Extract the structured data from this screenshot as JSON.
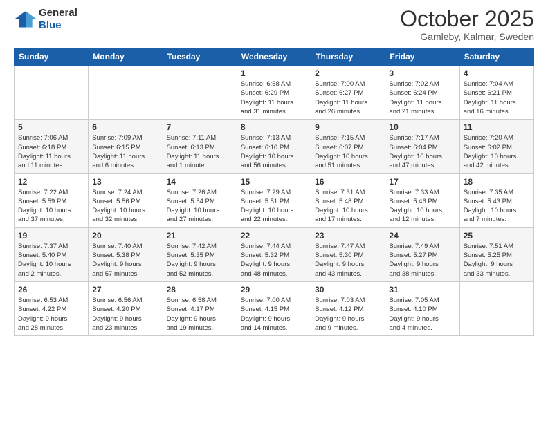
{
  "logo": {
    "general": "General",
    "blue": "Blue"
  },
  "header": {
    "month": "October 2025",
    "location": "Gamleby, Kalmar, Sweden"
  },
  "weekdays": [
    "Sunday",
    "Monday",
    "Tuesday",
    "Wednesday",
    "Thursday",
    "Friday",
    "Saturday"
  ],
  "weeks": [
    [
      {
        "day": "",
        "info": ""
      },
      {
        "day": "",
        "info": ""
      },
      {
        "day": "",
        "info": ""
      },
      {
        "day": "1",
        "info": "Sunrise: 6:58 AM\nSunset: 6:29 PM\nDaylight: 11 hours\nand 31 minutes."
      },
      {
        "day": "2",
        "info": "Sunrise: 7:00 AM\nSunset: 6:27 PM\nDaylight: 11 hours\nand 26 minutes."
      },
      {
        "day": "3",
        "info": "Sunrise: 7:02 AM\nSunset: 6:24 PM\nDaylight: 11 hours\nand 21 minutes."
      },
      {
        "day": "4",
        "info": "Sunrise: 7:04 AM\nSunset: 6:21 PM\nDaylight: 11 hours\nand 16 minutes."
      }
    ],
    [
      {
        "day": "5",
        "info": "Sunrise: 7:06 AM\nSunset: 6:18 PM\nDaylight: 11 hours\nand 11 minutes."
      },
      {
        "day": "6",
        "info": "Sunrise: 7:09 AM\nSunset: 6:15 PM\nDaylight: 11 hours\nand 6 minutes."
      },
      {
        "day": "7",
        "info": "Sunrise: 7:11 AM\nSunset: 6:13 PM\nDaylight: 11 hours\nand 1 minute."
      },
      {
        "day": "8",
        "info": "Sunrise: 7:13 AM\nSunset: 6:10 PM\nDaylight: 10 hours\nand 56 minutes."
      },
      {
        "day": "9",
        "info": "Sunrise: 7:15 AM\nSunset: 6:07 PM\nDaylight: 10 hours\nand 51 minutes."
      },
      {
        "day": "10",
        "info": "Sunrise: 7:17 AM\nSunset: 6:04 PM\nDaylight: 10 hours\nand 47 minutes."
      },
      {
        "day": "11",
        "info": "Sunrise: 7:20 AM\nSunset: 6:02 PM\nDaylight: 10 hours\nand 42 minutes."
      }
    ],
    [
      {
        "day": "12",
        "info": "Sunrise: 7:22 AM\nSunset: 5:59 PM\nDaylight: 10 hours\nand 37 minutes."
      },
      {
        "day": "13",
        "info": "Sunrise: 7:24 AM\nSunset: 5:56 PM\nDaylight: 10 hours\nand 32 minutes."
      },
      {
        "day": "14",
        "info": "Sunrise: 7:26 AM\nSunset: 5:54 PM\nDaylight: 10 hours\nand 27 minutes."
      },
      {
        "day": "15",
        "info": "Sunrise: 7:29 AM\nSunset: 5:51 PM\nDaylight: 10 hours\nand 22 minutes."
      },
      {
        "day": "16",
        "info": "Sunrise: 7:31 AM\nSunset: 5:48 PM\nDaylight: 10 hours\nand 17 minutes."
      },
      {
        "day": "17",
        "info": "Sunrise: 7:33 AM\nSunset: 5:46 PM\nDaylight: 10 hours\nand 12 minutes."
      },
      {
        "day": "18",
        "info": "Sunrise: 7:35 AM\nSunset: 5:43 PM\nDaylight: 10 hours\nand 7 minutes."
      }
    ],
    [
      {
        "day": "19",
        "info": "Sunrise: 7:37 AM\nSunset: 5:40 PM\nDaylight: 10 hours\nand 2 minutes."
      },
      {
        "day": "20",
        "info": "Sunrise: 7:40 AM\nSunset: 5:38 PM\nDaylight: 9 hours\nand 57 minutes."
      },
      {
        "day": "21",
        "info": "Sunrise: 7:42 AM\nSunset: 5:35 PM\nDaylight: 9 hours\nand 52 minutes."
      },
      {
        "day": "22",
        "info": "Sunrise: 7:44 AM\nSunset: 5:32 PM\nDaylight: 9 hours\nand 48 minutes."
      },
      {
        "day": "23",
        "info": "Sunrise: 7:47 AM\nSunset: 5:30 PM\nDaylight: 9 hours\nand 43 minutes."
      },
      {
        "day": "24",
        "info": "Sunrise: 7:49 AM\nSunset: 5:27 PM\nDaylight: 9 hours\nand 38 minutes."
      },
      {
        "day": "25",
        "info": "Sunrise: 7:51 AM\nSunset: 5:25 PM\nDaylight: 9 hours\nand 33 minutes."
      }
    ],
    [
      {
        "day": "26",
        "info": "Sunrise: 6:53 AM\nSunset: 4:22 PM\nDaylight: 9 hours\nand 28 minutes."
      },
      {
        "day": "27",
        "info": "Sunrise: 6:56 AM\nSunset: 4:20 PM\nDaylight: 9 hours\nand 23 minutes."
      },
      {
        "day": "28",
        "info": "Sunrise: 6:58 AM\nSunset: 4:17 PM\nDaylight: 9 hours\nand 19 minutes."
      },
      {
        "day": "29",
        "info": "Sunrise: 7:00 AM\nSunset: 4:15 PM\nDaylight: 9 hours\nand 14 minutes."
      },
      {
        "day": "30",
        "info": "Sunrise: 7:03 AM\nSunset: 4:12 PM\nDaylight: 9 hours\nand 9 minutes."
      },
      {
        "day": "31",
        "info": "Sunrise: 7:05 AM\nSunset: 4:10 PM\nDaylight: 9 hours\nand 4 minutes."
      },
      {
        "day": "",
        "info": ""
      }
    ]
  ]
}
